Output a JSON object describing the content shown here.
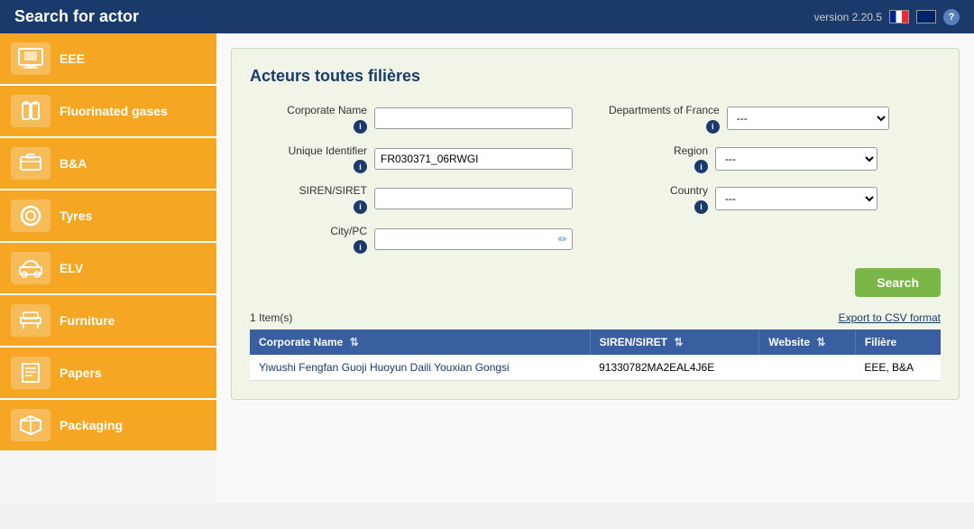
{
  "header": {
    "title": "Search for actor",
    "version": "version 2.20.5",
    "lang_fr": "FR",
    "lang_uk": "UK",
    "help": "?"
  },
  "sidebar": {
    "items": [
      {
        "id": "eee",
        "label": "EEE",
        "icon": "🖥"
      },
      {
        "id": "fluorinated",
        "label": "Fluorinated gases",
        "icon": "🧯"
      },
      {
        "id": "ba",
        "label": "B&A",
        "icon": "🔋"
      },
      {
        "id": "tyres",
        "label": "Tyres",
        "icon": "⭕"
      },
      {
        "id": "elv",
        "label": "ELV",
        "icon": "🪑"
      },
      {
        "id": "furniture",
        "label": "Furniture",
        "icon": "🪑"
      },
      {
        "id": "papers",
        "label": "Papers",
        "icon": "📄"
      },
      {
        "id": "packaging",
        "label": "Packaging",
        "icon": "📦"
      }
    ]
  },
  "content": {
    "section_title": "Acteurs toutes filières",
    "form": {
      "corporate_name_label": "Corporate Name",
      "unique_identifier_label": "Unique Identifier",
      "siren_siret_label": "SIREN/SIRET",
      "city_pc_label": "City/PC",
      "departments_label": "Departments of France",
      "region_label": "Region",
      "country_label": "Country",
      "corporate_name_value": "",
      "unique_identifier_value": "FR030371_06RWGI",
      "siren_siret_value": "",
      "city_pc_value": "",
      "departments_default": "---",
      "region_default": "---",
      "country_default": "---",
      "search_btn": "Search",
      "export_link": "Export to CSV format"
    },
    "results": {
      "count_text": "1 Item(s)",
      "table": {
        "headers": [
          {
            "label": "Corporate Name",
            "sortable": true
          },
          {
            "label": "SIREN/SIRET",
            "sortable": true
          },
          {
            "label": "Website",
            "sortable": true
          },
          {
            "label": "Filière",
            "sortable": false
          }
        ],
        "rows": [
          {
            "corporate_name": "Yiwushi Fengfan Guoji Huoyun Daili Youxian Gongsi",
            "siren_siret": "91330782MA2EAL4J6E",
            "website": "",
            "filiere": "EEE, B&A"
          }
        ]
      }
    }
  }
}
